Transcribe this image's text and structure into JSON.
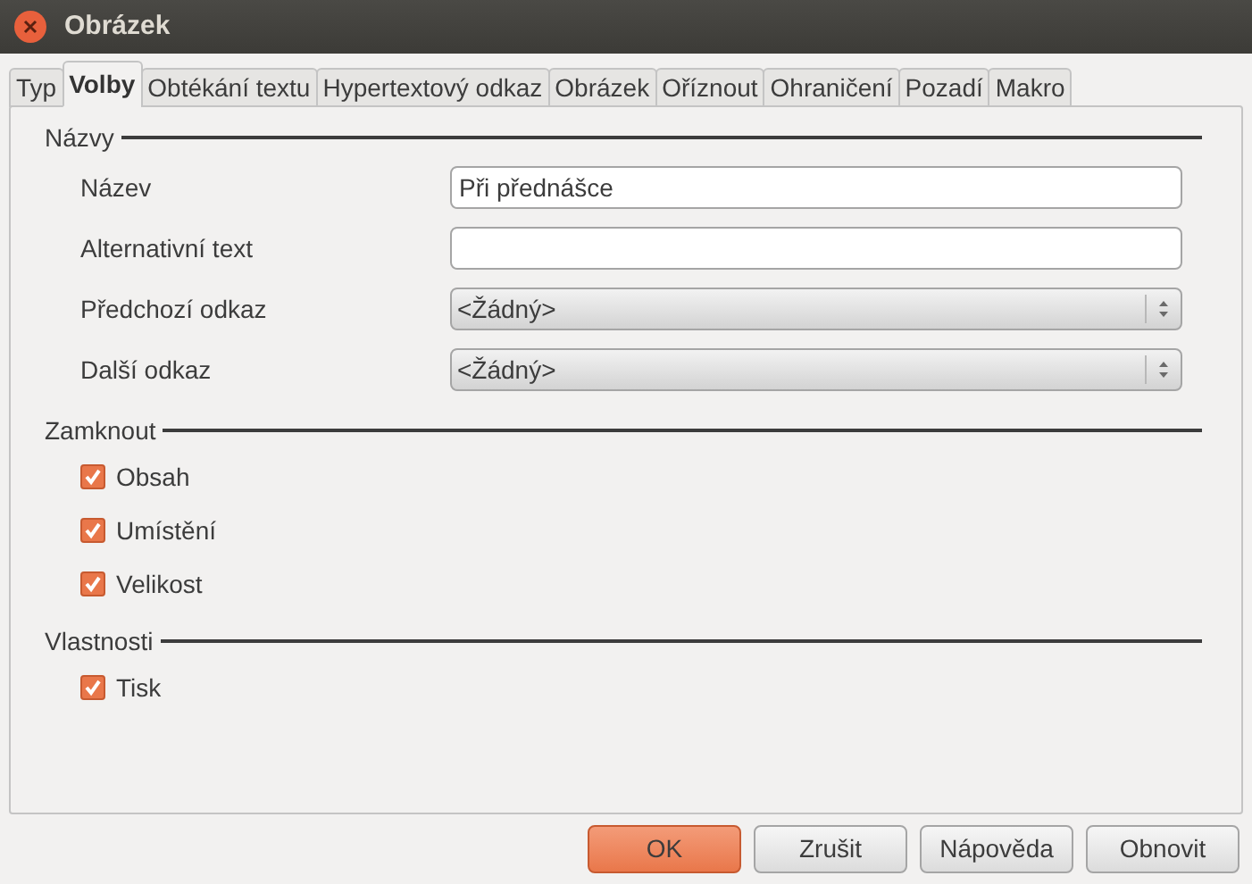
{
  "window": {
    "title": "Obrázek"
  },
  "tabs": [
    {
      "label": "Typ",
      "selected": false
    },
    {
      "label": "Volby",
      "selected": true
    },
    {
      "label": "Obtékání textu",
      "selected": false
    },
    {
      "label": "Hypertextový odkaz",
      "selected": false
    },
    {
      "label": "Obrázek",
      "selected": false
    },
    {
      "label": "Oříznout",
      "selected": false
    },
    {
      "label": "Ohraničení",
      "selected": false
    },
    {
      "label": "Pozadí",
      "selected": false
    },
    {
      "label": "Makro",
      "selected": false
    }
  ],
  "sections": [
    {
      "title": "Názvy",
      "items": [
        {
          "kind": "text",
          "label": "Název",
          "value": "Při přednášce"
        },
        {
          "kind": "text",
          "label": "Alternativní text",
          "value": ""
        },
        {
          "kind": "select",
          "label": "Předchozí odkaz",
          "value": "<Žádný>"
        },
        {
          "kind": "select",
          "label": "Další odkaz",
          "value": "<Žádný>"
        }
      ]
    },
    {
      "title": "Zamknout",
      "items": [
        {
          "kind": "checkbox",
          "label": "Obsah",
          "checked": true
        },
        {
          "kind": "checkbox",
          "label": "Umístění",
          "checked": true
        },
        {
          "kind": "checkbox",
          "label": "Velikost",
          "checked": true
        }
      ]
    },
    {
      "title": "Vlastnosti",
      "items": [
        {
          "kind": "checkbox",
          "label": "Tisk",
          "checked": true
        }
      ]
    }
  ],
  "buttons": [
    {
      "label": "OK",
      "default": true
    },
    {
      "label": "Zrušit",
      "default": false
    },
    {
      "label": "Nápověda",
      "default": false
    },
    {
      "label": "Obnovit",
      "default": false
    }
  ]
}
